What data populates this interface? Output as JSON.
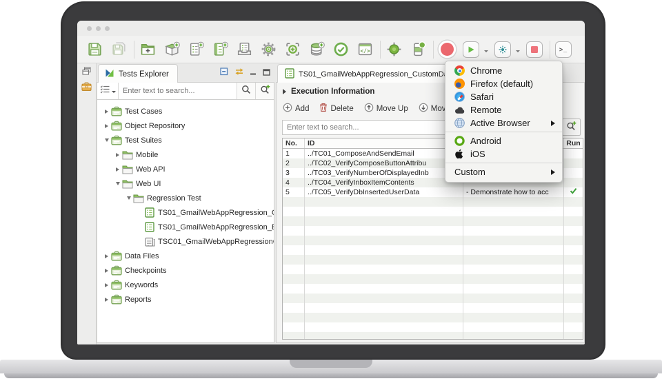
{
  "window": {
    "traffic_lights": 3
  },
  "toolbar": {
    "items": [
      {
        "icon": "save"
      },
      {
        "icon": "save-all",
        "disabled": true
      },
      {
        "sep": true
      },
      {
        "icon": "new-folder"
      },
      {
        "icon": "new-package"
      },
      {
        "icon": "new-test-case"
      },
      {
        "icon": "new-test-suite"
      },
      {
        "icon": "test-suite-collection"
      },
      {
        "icon": "settings-gear"
      },
      {
        "icon": "capture-object"
      },
      {
        "icon": "new-data-file"
      },
      {
        "icon": "checkpoint"
      },
      {
        "icon": "custom-keyword"
      },
      {
        "sep": true
      },
      {
        "icon": "spy-web"
      },
      {
        "icon": "record-mobile"
      },
      {
        "sep": true
      },
      {
        "icon": "record"
      },
      {
        "icon": "run",
        "caret": true
      },
      {
        "icon": "debug",
        "caret": true
      },
      {
        "icon": "stop"
      },
      {
        "sep": true
      },
      {
        "icon": "console"
      }
    ]
  },
  "ministrip": {
    "icons": [
      "restore-panel",
      "toolbox"
    ]
  },
  "explorer": {
    "title": "Tests Explorer",
    "logo_icon": "katalon-logo",
    "header_icons": [
      "collapse-all",
      "sync",
      "minimize",
      "maximize"
    ],
    "search": {
      "placeholder": "Enter text to search...",
      "icons": [
        "filter",
        "search",
        "search-add"
      ]
    },
    "tree": [
      {
        "label": "Test Cases",
        "level": 0,
        "arrow": "right",
        "icon": "case"
      },
      {
        "label": "Object Repository",
        "level": 0,
        "arrow": "right",
        "icon": "case"
      },
      {
        "label": "Test Suites",
        "level": 0,
        "arrow": "down",
        "icon": "case"
      },
      {
        "label": "Mobile",
        "level": 1,
        "arrow": "right",
        "icon": "folder"
      },
      {
        "label": "Web API",
        "level": 1,
        "arrow": "right",
        "icon": "folder"
      },
      {
        "label": "Web UI",
        "level": 1,
        "arrow": "down",
        "icon": "folder"
      },
      {
        "label": "Regression Test",
        "level": 2,
        "arrow": "down",
        "icon": "folder"
      },
      {
        "label": "TS01_GmailWebAppRegression_C",
        "level": 3,
        "arrow": "none",
        "icon": "tsdoc"
      },
      {
        "label": "TS01_GmailWebAppRegression_E",
        "level": 3,
        "arrow": "none",
        "icon": "tsdoc"
      },
      {
        "label": "TSC01_GmailWebAppRegressionC",
        "level": 3,
        "arrow": "none",
        "icon": "tscol"
      },
      {
        "label": "Data Files",
        "level": 0,
        "arrow": "right",
        "icon": "case"
      },
      {
        "label": "Checkpoints",
        "level": 0,
        "arrow": "right",
        "icon": "case"
      },
      {
        "label": "Keywords",
        "level": 0,
        "arrow": "right",
        "icon": "case"
      },
      {
        "label": "Reports",
        "level": 0,
        "arrow": "right",
        "icon": "case"
      }
    ]
  },
  "main": {
    "tab": {
      "title": "TS01_GmailWebAppRegression_CustomDa",
      "icon": "tsdoc"
    },
    "section": {
      "title": "Execution Information"
    },
    "actions": [
      {
        "label": "Add",
        "icon": "circle-plus"
      },
      {
        "label": "Delete",
        "icon": "trash"
      },
      {
        "label": "Move Up",
        "icon": "circle-up"
      },
      {
        "label": "Move Down",
        "icon": "circle-down"
      }
    ],
    "search": {
      "placeholder": "Enter text to search...",
      "icon": "search-add"
    },
    "table": {
      "headers": [
        "No.",
        "ID",
        "",
        "Run"
      ],
      "rows": [
        {
          "no": "1",
          "id": "../TC01_ComposeAndSendEmail",
          "desc": "",
          "run": false
        },
        {
          "no": "2",
          "id": "../TC02_VerifyComposeButtonAttribu",
          "desc": "",
          "run": false
        },
        {
          "no": "3",
          "id": "../TC03_VerifyNumberOfDisplayedInb",
          "desc": "",
          "run": false
        },
        {
          "no": "4",
          "id": "../TC04_VerifyInboxItemContents",
          "desc": "",
          "run": false
        },
        {
          "no": "5",
          "id": "../TC05_VerifyDbInsertedUserData",
          "desc": "- Demonstrate how to acc",
          "run": true
        }
      ],
      "empty_rows": 16
    }
  },
  "menu": {
    "items": [
      {
        "label": "Chrome",
        "icon": "chrome"
      },
      {
        "label": "Firefox (default)",
        "icon": "firefox"
      },
      {
        "label": "Safari",
        "icon": "safari"
      },
      {
        "label": "Remote",
        "icon": "cloud"
      },
      {
        "label": "Active Browser",
        "icon": "globe",
        "submenu": true
      },
      {
        "sep": true
      },
      {
        "label": "Android",
        "icon": "android"
      },
      {
        "label": "iOS",
        "icon": "apple"
      },
      {
        "sep": true
      },
      {
        "label": "Custom",
        "icon": "",
        "submenu": true
      }
    ]
  },
  "colors": {
    "accent_green": "#76b043",
    "record_red": "#ec686e",
    "stop_pink": "#ef747c",
    "check_green": "#3fa33c",
    "menu_bg": "#f3f3f1",
    "bezel": "#3b3b3d"
  }
}
